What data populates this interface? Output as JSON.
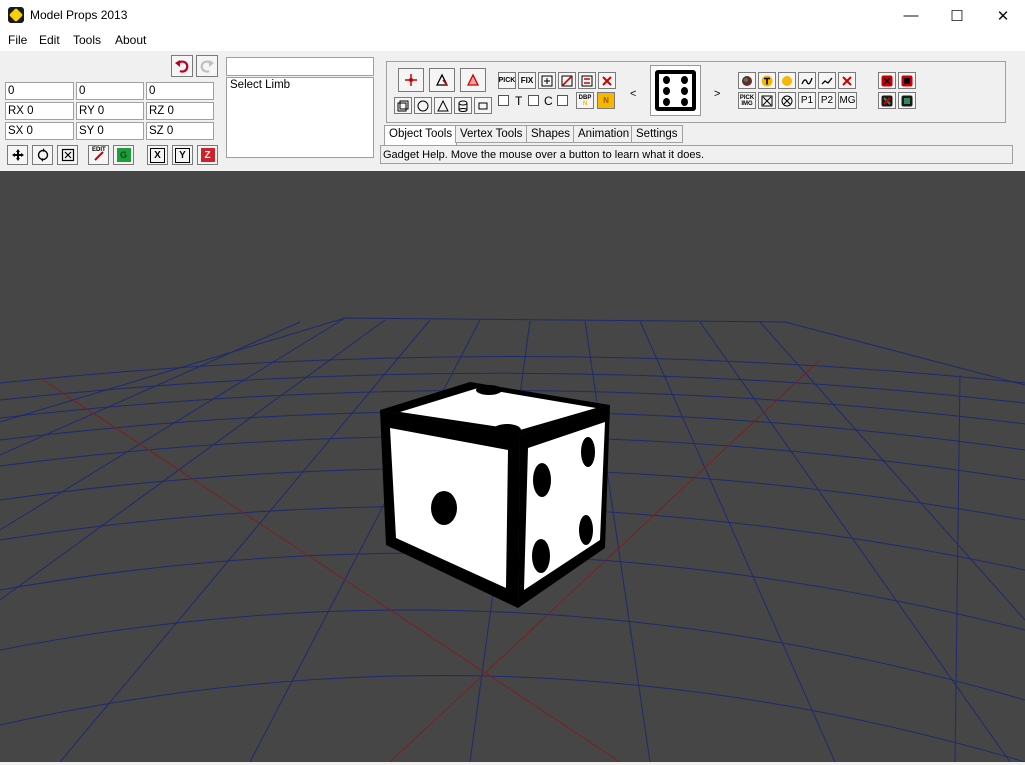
{
  "window": {
    "title": "Model Props 2013",
    "controls": [
      "—",
      "☐",
      "✕"
    ]
  },
  "menu": [
    "File",
    "Edit",
    "Tools",
    "About"
  ],
  "coords": {
    "position": [
      "0",
      "0",
      "0"
    ],
    "rotation": [
      "RX 0",
      "RY 0",
      "RZ 0"
    ],
    "scale": [
      "SX 0",
      "SY 0",
      "SZ 0"
    ]
  },
  "axis_buttons": [
    "X",
    "Y",
    "Z"
  ],
  "edit_button": "EDIT",
  "green_button": "G",
  "search": {
    "value": ""
  },
  "limb_list": [
    "Select Limb"
  ],
  "tool_labels": {
    "pick": "PICK",
    "fix": "FIX",
    "dbp": "DBP",
    "n": "N",
    "t": "T",
    "c": "C",
    "pick_img": "PICK IMG",
    "p1": "P1",
    "p2": "P2",
    "mg": "MG"
  },
  "nav": {
    "prev": "<",
    "next": ">"
  },
  "tabs": [
    "Object Tools",
    "Vertex Tools",
    "Shapes",
    "Animation",
    "Settings"
  ],
  "help_text": "Gadget Help.  Move the mouse over a button to learn what it does.",
  "colors": {
    "viewport": "#464646",
    "grid_blue": "#1e2a6e",
    "grid_red": "#7a2020",
    "axis_green": "#1e9e3a",
    "axis_red": "#d0202a",
    "accent_yellow": "#f5b800"
  }
}
